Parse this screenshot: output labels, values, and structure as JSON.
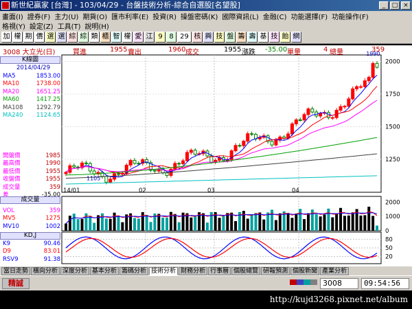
{
  "window": {
    "title": "新世紀贏家 [台灣] - 103/04/29 - 台盤技術分析-綜合自選股[名望股]"
  },
  "menu_row1": [
    "畫面(I)",
    "證券(F)",
    "主力(U)",
    "期貨(O)",
    "匯市利率(E)",
    "投資(R)",
    "操盤密碼(K)",
    "國際資訊(L)",
    "金融(C)",
    "功能選擇(F)",
    "功能操作(F)"
  ],
  "menu_row2": [
    "格視(Y)",
    "設定(Z)",
    "工具(T)",
    "說明(H)"
  ],
  "toolbar": [
    "加",
    "權",
    "期",
    "價",
    "選",
    "選",
    "綜",
    "綜",
    "類",
    "櫃",
    "智",
    "權",
    "愛",
    "江",
    "9",
    "8",
    "29",
    "核",
    "興",
    "技",
    "盤",
    "籌",
    "壽",
    "基",
    "技",
    "飴",
    "網"
  ],
  "quote": {
    "symbol": "3008 大立光(日)",
    "bid_label": "買進",
    "bid": "1955",
    "ask_label": "賣出",
    "ask": "1960",
    "last_label": "成交",
    "last": "1955",
    "change_label": "漲跌",
    "change": "-35.00",
    "volume_label": "單量",
    "volume": "4",
    "total_label": "總量",
    "total": "359"
  },
  "kline": {
    "title": "K線圖",
    "date": "2014/04/29",
    "ma": [
      {
        "name": "MA5",
        "value": "1853.00",
        "color": "#0000ff"
      },
      {
        "name": "MA10",
        "value": "1738.00",
        "color": "#ff0000"
      },
      {
        "name": "MA20",
        "value": "1651.25",
        "color": "#ff00ff"
      },
      {
        "name": "MA60",
        "value": "1417.25",
        "color": "#00a000"
      },
      {
        "name": "MA108",
        "value": "1292.79",
        "color": "#404040"
      },
      {
        "name": "MA240",
        "value": "1124.65",
        "color": "#00c0c0"
      }
    ],
    "ohlc": [
      {
        "label": "開盤價",
        "value": "1985"
      },
      {
        "label": "最高價",
        "value": "1990"
      },
      {
        "label": "最低價",
        "value": "1955"
      },
      {
        "label": "收盤價",
        "value": "1955"
      },
      {
        "label": "成交量",
        "value": "359"
      },
      {
        "label": "差",
        "value": "-35.00"
      }
    ],
    "y_ticks": [
      "2000",
      "1750",
      "1500",
      "1250"
    ],
    "high_label": "1990",
    "low_label": "1105",
    "x_ticks": [
      "14/01",
      "02",
      "03",
      "04"
    ]
  },
  "volume": {
    "title": "成交量",
    "rows": [
      {
        "name": "VOL",
        "value": "359",
        "color": "#ff00ff"
      },
      {
        "name": "MV5",
        "value": "1275",
        "color": "#ff0000"
      },
      {
        "name": "MV10",
        "value": "1002",
        "color": "#0000ff"
      }
    ],
    "y_ticks": [
      "2000",
      "1000",
      "0"
    ]
  },
  "kd": {
    "title": "KD,J",
    "rows": [
      {
        "name": "K9",
        "value": "90.46",
        "color": "#0000ff"
      },
      {
        "name": "D9",
        "value": "83.01",
        "color": "#ff0000"
      },
      {
        "name": "RSV9",
        "value": "91.38",
        "color": "#0000ff"
      }
    ],
    "y_ticks": [
      "80",
      "50",
      "20"
    ]
  },
  "tabs": [
    "當日走勢",
    "橫向分析",
    "深度分析",
    "基本分析",
    "籌碼分析",
    "技術分析",
    "財務分析",
    "行事曆",
    "個股總覽",
    "研報預測",
    "個股新聞",
    "產業分析"
  ],
  "active_tab": 5,
  "status": {
    "app": "精誠",
    "code": "3008",
    "clock": "09:54:56"
  },
  "footer": {
    "url": "http://kujd3268.pixnet.net/album"
  },
  "colors": {
    "up": "#ff0000",
    "down": "#008000",
    "background": "#ffffff",
    "accent": "#0a246a"
  }
}
